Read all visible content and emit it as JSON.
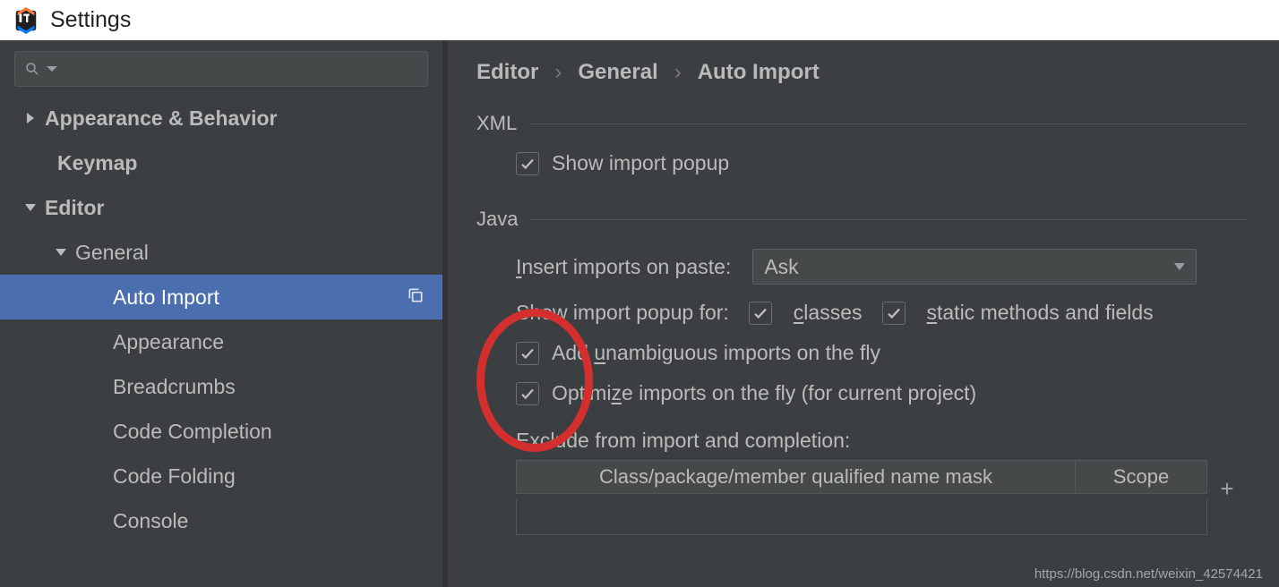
{
  "window": {
    "title": "Settings"
  },
  "sidebar": {
    "search_placeholder": "",
    "items": [
      {
        "label": "Appearance & Behavior",
        "expandable": true,
        "open": false,
        "level": 0
      },
      {
        "label": "Keymap",
        "expandable": false,
        "level": 0
      },
      {
        "label": "Editor",
        "expandable": true,
        "open": true,
        "level": 0
      },
      {
        "label": "General",
        "expandable": true,
        "open": true,
        "level": 1
      },
      {
        "label": "Auto Import",
        "expandable": false,
        "level": 2,
        "selected": true
      },
      {
        "label": "Appearance",
        "expandable": false,
        "level": 2
      },
      {
        "label": "Breadcrumbs",
        "expandable": false,
        "level": 2
      },
      {
        "label": "Code Completion",
        "expandable": false,
        "level": 2
      },
      {
        "label": "Code Folding",
        "expandable": false,
        "level": 2
      },
      {
        "label": "Console",
        "expandable": false,
        "level": 2
      }
    ]
  },
  "breadcrumb": {
    "parts": [
      "Editor",
      "General",
      "Auto Import"
    ]
  },
  "content": {
    "xml": {
      "section": "XML",
      "show_popup_label": "Show import popup",
      "show_popup_checked": true
    },
    "java": {
      "section": "Java",
      "paste_label_pre": "I",
      "paste_label_post": "nsert imports on paste:",
      "paste_value": "Ask",
      "show_popup_for_label": "Show import popup for:",
      "classes_checked": true,
      "classes_pre": "c",
      "classes_post": "lasses",
      "static_checked": true,
      "static_pre": "s",
      "static_post": "tatic methods and fields",
      "add_fly_checked": true,
      "add_fly_pre": "Add ",
      "add_fly_ul": "u",
      "add_fly_post": "nambiguous imports on the fly",
      "opt_fly_checked": true,
      "opt_fly_pre": "Optimi",
      "opt_fly_ul": "z",
      "opt_fly_post": "e imports on the fly (for current project)",
      "exclude_label": "Exclude from import and completion:",
      "table": {
        "col_name": "Class/package/member qualified name mask",
        "col_scope": "Scope",
        "add": "+"
      }
    }
  },
  "watermark": "https://blog.csdn.net/weixin_42574421"
}
